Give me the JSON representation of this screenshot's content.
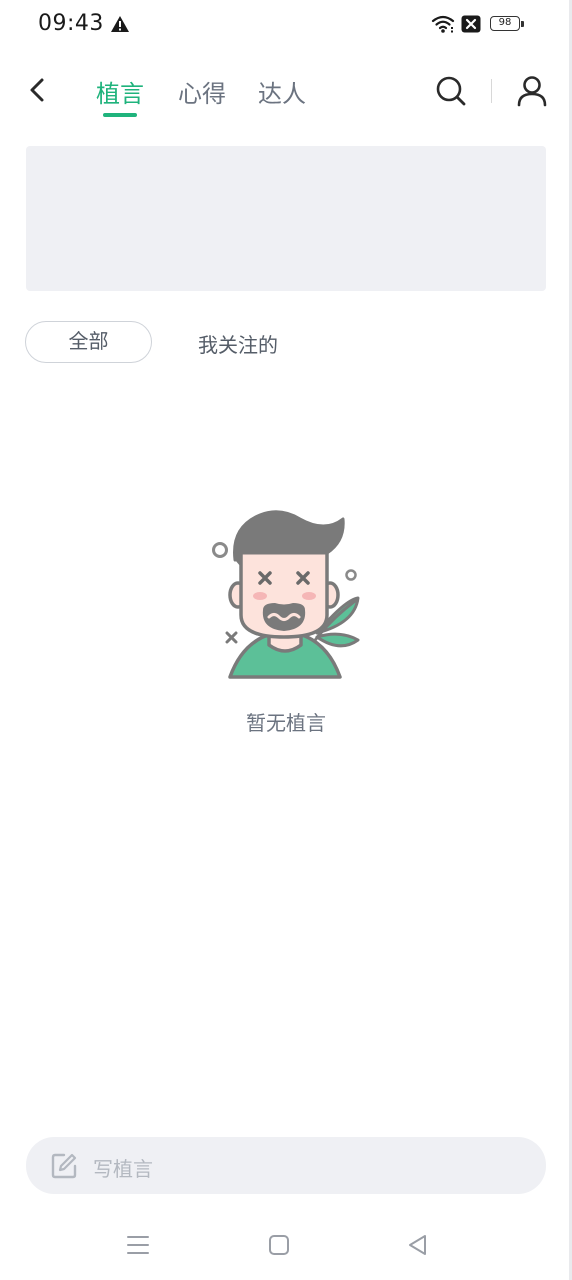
{
  "status_bar": {
    "time": "09:43",
    "battery_level": "98",
    "icons": [
      "warning-icon",
      "wifi-icon",
      "sim-blocked-icon",
      "battery-icon"
    ]
  },
  "header": {
    "back_icon": "chevron-left-icon",
    "tabs": [
      {
        "label": "植言",
        "active": true
      },
      {
        "label": "心得",
        "active": false
      },
      {
        "label": "达人",
        "active": false
      }
    ],
    "search_icon": "search-icon",
    "user_icon": "user-icon"
  },
  "filters": {
    "all_label": "全部",
    "following_label": "我关注的",
    "selected": "全部"
  },
  "empty_state": {
    "illustration": "confused-man-with-plant",
    "text": "暂无植言"
  },
  "compose": {
    "icon": "edit-icon",
    "placeholder": "写植言"
  },
  "nav": {
    "icons": [
      "menu-icon",
      "home-square-icon",
      "back-triangle-icon"
    ]
  },
  "colors": {
    "accent": "#1fb37c",
    "tab_inactive": "#6b7380",
    "banner_bg": "#eff0f4",
    "placeholder": "#b3b8c0",
    "illustration_shirt": "#5cc098",
    "illustration_hair": "#7a7a7a"
  }
}
